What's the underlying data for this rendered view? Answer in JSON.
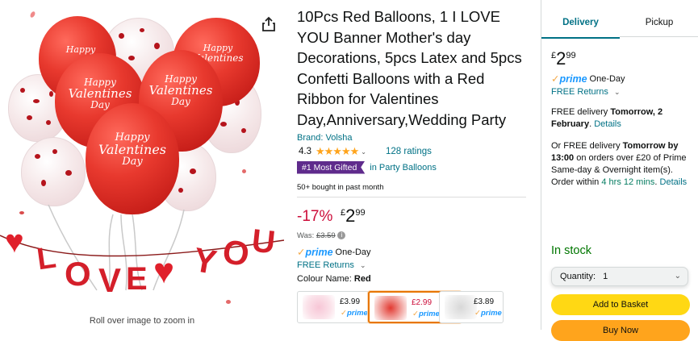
{
  "image": {
    "zoom_hint": "Roll over image to zoom in",
    "balloon_text": [
      "Happy",
      "Valentines",
      "Day"
    ],
    "banner_letters": [
      "L",
      "O",
      "V",
      "E",
      "Y",
      "O",
      "U"
    ]
  },
  "product": {
    "title": "10Pcs Red Balloons, 1 I LOVE YOU Banner Mother's day Decorations, 5pcs Latex and 5pcs Confetti Balloons with a Red Ribbon for Valentines Day,Anniversary,Wedding Party",
    "brand": "Brand: Volsha",
    "rating": "4.3",
    "stars": "★★★★★",
    "ratings_count": "128 ratings",
    "badge": "#1 Most Gifted",
    "badge_category": "in Party Balloons",
    "bought": "50+ bought in past month",
    "discount": "-17%",
    "price_currency": "£",
    "price_whole": "2",
    "price_fraction": "99",
    "was_label": "Was:",
    "was_price": "£3.59",
    "prime_label": "prime",
    "prime_check": "✓",
    "prime_delivery": "One-Day",
    "returns": "FREE Returns",
    "colour_label": "Colour Name:",
    "colour_value": "Red",
    "swatches": [
      {
        "price": "£3.99",
        "prime": "prime"
      },
      {
        "price": "£2.99",
        "prime": "prime"
      },
      {
        "price": "£3.89",
        "prime": "prime"
      }
    ]
  },
  "buybox": {
    "tab_delivery": "Delivery",
    "tab_pickup": "Pickup",
    "price_currency": "£",
    "price_whole": "2",
    "price_fraction": "99",
    "prime_label": "prime",
    "prime_check": "✓",
    "prime_delivery": "One-Day",
    "returns": "FREE Returns",
    "delivery1_prefix": "FREE delivery",
    "delivery1_date": "Tomorrow, 2 February",
    "delivery1_link": "Details",
    "delivery2_prefix": "Or FREE delivery",
    "delivery2_date": "Tomorrow by 13:00",
    "delivery2_mid": "on orders over £20 of Prime Same-day & Overnight item(s). Order within",
    "delivery2_time": "4 hrs 12 mins",
    "delivery2_link": "Details",
    "stock": "In stock",
    "quantity_label": "Quantity:",
    "quantity_value": "1",
    "add_to_basket": "Add to Basket",
    "buy_now": "Buy Now"
  },
  "colors": {
    "link": "#007185",
    "discount": "#cc0c39",
    "add_to_basket": "#ffd814",
    "buy_now": "#ffa41c",
    "badge": "#5f2b8c",
    "in_stock": "#007600",
    "prime_check": "#f3a847"
  }
}
